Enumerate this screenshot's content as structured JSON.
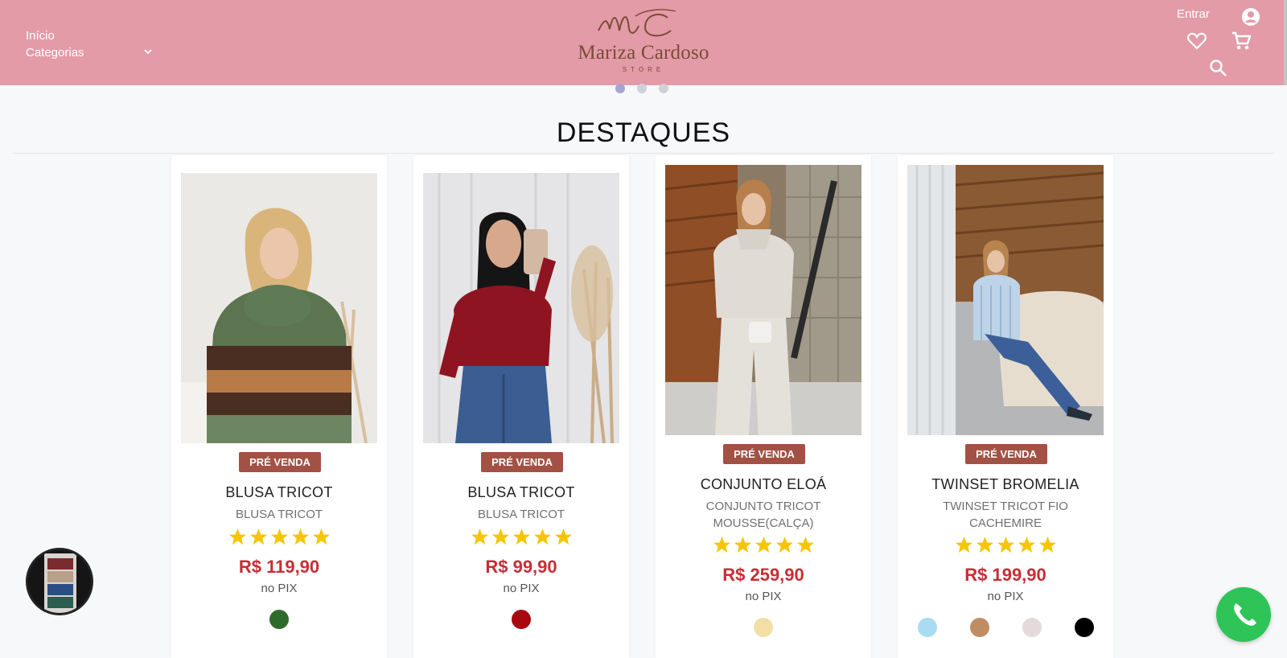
{
  "header": {
    "nav": {
      "home_label": "Início",
      "categories_label": "Categorias"
    },
    "logo": {
      "name": "Mariza Cardoso",
      "tagline": "STORE"
    },
    "login_label": "Entrar",
    "icons": [
      "account-icon",
      "heart-icon",
      "cart-icon",
      "search-icon",
      "chevron-down-icon"
    ]
  },
  "carousel": {
    "dot_count": 3,
    "active_index": 0
  },
  "section": {
    "title": "DESTAQUES"
  },
  "products": [
    {
      "badge": "PRÉ VENDA",
      "name": "BLUSA TRICOT",
      "subtitle": "BLUSA TRICOT",
      "rating": 5,
      "price": "R$ 119,90",
      "price_note": "no PIX",
      "colors": [
        "#2e6b2b"
      ]
    },
    {
      "badge": "PRÉ VENDA",
      "name": "BLUSA TRICOT",
      "subtitle": "BLUSA TRICOT",
      "rating": 5,
      "price": "R$ 99,90",
      "price_note": "no PIX",
      "colors": [
        "#a8090e"
      ]
    },
    {
      "badge": "PRÉ VENDA",
      "name": "CONJUNTO ELOÁ",
      "subtitle": "CONJUNTO TRICOT MOUSSE(CALÇA)",
      "rating": 5,
      "price": "R$ 259,90",
      "price_note": "no PIX",
      "colors": [
        "#f1dfa6"
      ]
    },
    {
      "badge": "PRÉ VENDA",
      "name": "TWINSET BROMELIA",
      "subtitle": "TWINSET TRICOT FIO CACHEMIRE",
      "rating": 5,
      "price": "R$ 199,90",
      "price_note": "no PIX",
      "colors": [
        "#a9dcf1",
        "#c08d62",
        "#e4dadb",
        "#000000"
      ]
    }
  ],
  "colors": {
    "header_bg": "#e39ba8",
    "badge_bg": "#a35144",
    "price": "#c62f35",
    "star": "#f7c500",
    "whatsapp": "#2ec458"
  }
}
